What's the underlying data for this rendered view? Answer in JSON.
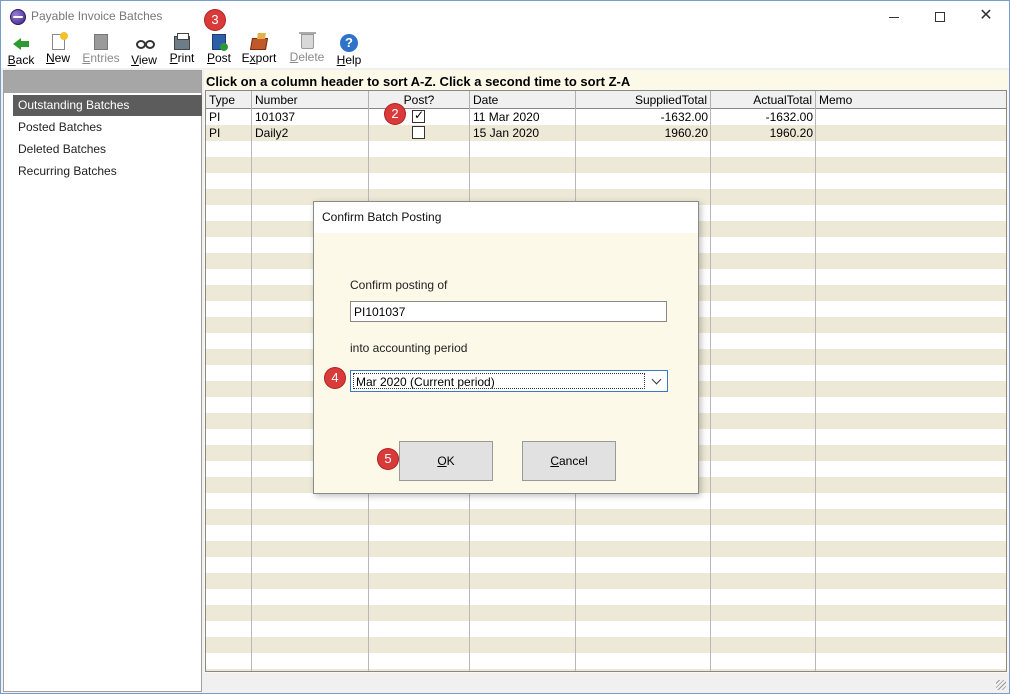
{
  "window": {
    "title": "Payable Invoice Batches"
  },
  "toolbar": {
    "back": {
      "label": "Back",
      "accel": "B",
      "rest": "ack"
    },
    "new": {
      "label": "New",
      "accel": "N",
      "rest": "ew"
    },
    "entries": {
      "label": "Entries",
      "accel": "E",
      "rest": "ntries"
    },
    "view": {
      "label": "View",
      "accel": "V",
      "rest": "iew"
    },
    "print": {
      "label": "Print",
      "accel": "P",
      "rest": "rint"
    },
    "post": {
      "label": "Post",
      "accel": "P",
      "rest": "ost"
    },
    "export": {
      "label": "Export",
      "pre": "E",
      "accel": "x",
      "rest": "port"
    },
    "delete": {
      "label": "Delete",
      "accel": "D",
      "rest": "elete"
    },
    "help": {
      "label": "Help",
      "accel": "H",
      "rest": "elp",
      "glyph": "?"
    }
  },
  "sidebar": {
    "items": [
      {
        "label": "Outstanding Batches",
        "selected": true
      },
      {
        "label": "Posted Batches"
      },
      {
        "label": "Deleted Batches"
      },
      {
        "label": "Recurring Batches"
      }
    ]
  },
  "main": {
    "hint": "Click on a column header to sort A-Z.  Click a second time to sort Z-A",
    "columns": [
      "Type",
      "Number",
      "Post?",
      "Date",
      "SuppliedTotal",
      "ActualTotal",
      "Memo"
    ],
    "rows": [
      {
        "type": "PI",
        "number": "101037",
        "post": true,
        "date": "11 Mar 2020",
        "supplied": "-1632.00",
        "actual": "-1632.00",
        "memo": ""
      },
      {
        "type": "PI",
        "number": "Daily2",
        "post": false,
        "date": "15 Jan 2020",
        "supplied": "1960.20",
        "actual": "1960.20",
        "memo": ""
      }
    ]
  },
  "dialog": {
    "title": "Confirm Batch Posting",
    "confirm_label": "Confirm posting of",
    "batch_value": "PI101037",
    "period_label": "into accounting period",
    "period_value": "Mar 2020 (Current period)",
    "ok": {
      "accel": "O",
      "rest": "K"
    },
    "cancel": {
      "accel": "C",
      "rest": "ancel"
    }
  },
  "markers": [
    "2",
    "3",
    "4",
    "5"
  ],
  "colors": {
    "marker": "#d93a3a",
    "panel_bg": "#fcf9e8",
    "selected_bg": "#5c5c5c"
  }
}
